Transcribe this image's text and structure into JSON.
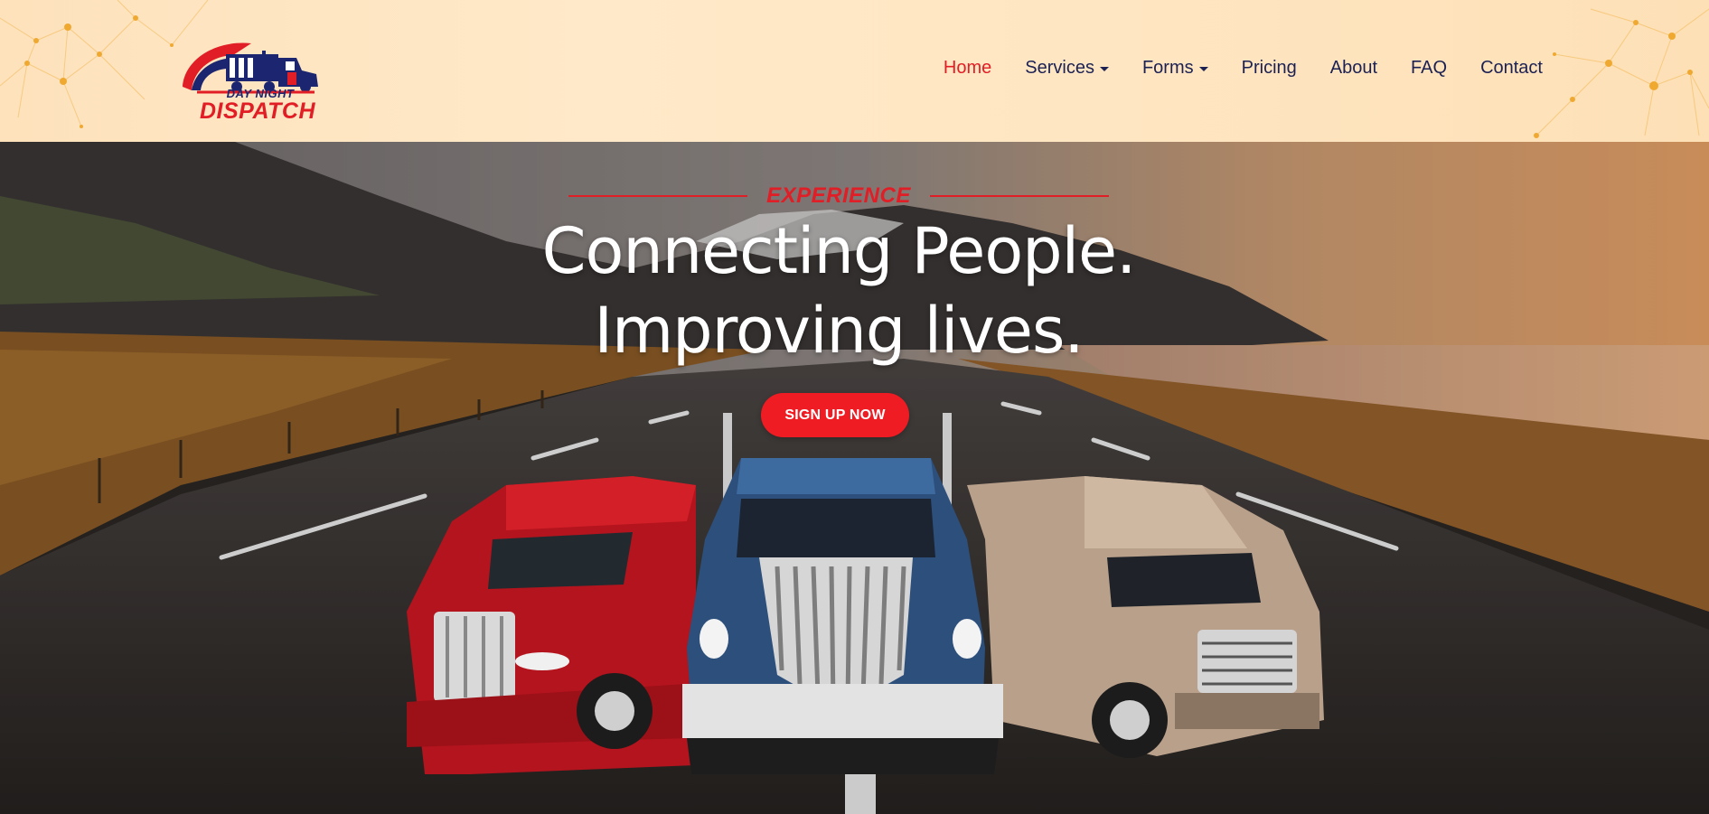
{
  "header": {
    "logo": {
      "line1": "DAY NIGHT",
      "line2": "DISPATCH"
    },
    "nav": [
      {
        "label": "Home",
        "active": true,
        "dropdown": false
      },
      {
        "label": "Services",
        "active": false,
        "dropdown": true
      },
      {
        "label": "Forms",
        "active": false,
        "dropdown": true
      },
      {
        "label": "Pricing",
        "active": false,
        "dropdown": false
      },
      {
        "label": "About",
        "active": false,
        "dropdown": false
      },
      {
        "label": "FAQ",
        "active": false,
        "dropdown": false
      },
      {
        "label": "Contact",
        "active": false,
        "dropdown": false
      }
    ]
  },
  "hero": {
    "eyebrow": "EXPERIENCE",
    "headline_line1": "Connecting People.",
    "headline_line2": "Improving lives.",
    "cta_label": "SIGN UP NOW"
  },
  "colors": {
    "accent_red": "#e11d25",
    "nav_text": "#1c2154",
    "header_bg": "#ffe6c2"
  }
}
